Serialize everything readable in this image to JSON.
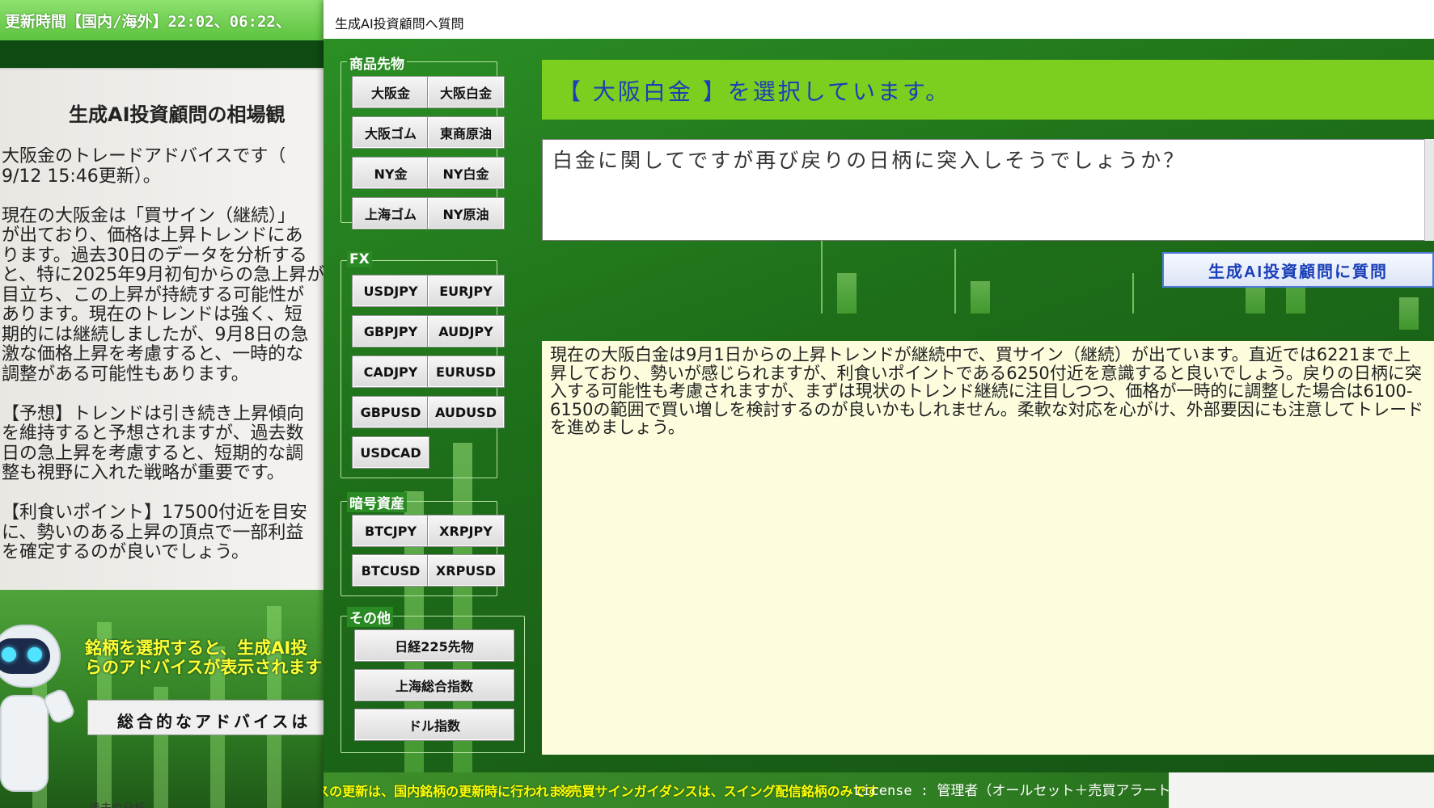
{
  "background_window": {
    "header_text": "更新時間【国内/海外】22:02、06:22、",
    "title": "生成AI投資顧問の相場観",
    "advice_text": "大阪金のトレードアドバイスです（\n9/12 15:46更新）。\n\n現在の大阪金は「買サイン（継続）」\nが出ており、価格は上昇トレンドにあ\nります。過去30日のデータを分析する\nと、特に2025年9月初旬からの急上昇が\n目立ち、この上昇が持続する可能性が\nあります。現在のトレンドは強く、短\n期的には継続しましたが、9月8日の急\n激な価格上昇を考慮すると、一時的な\n調整がある可能性もあります。\n\n【予想】トレンドは引き続き上昇傾向\nを維持すると予想されますが、過去数\n日の急上昇を考慮すると、短期的な調\n整も視野に入れた戦略が重要です。\n\n【利食いポイント】17500付近を目安\nに、勢いのある上昇の頂点で一部利益\nを確定するのが良いでしょう。",
    "yellow_note": "銘柄を選択すると、生成AI投\nらのアドバイスが表示されます",
    "overall_button": "総合的なアドバイスは",
    "bottom_text": "過去の分析"
  },
  "dialog": {
    "title": "生成AI投資顧問へ質問",
    "groups": {
      "commodities": {
        "label": "商品先物",
        "buttons": [
          "大阪金",
          "大阪白金",
          "大阪ゴム",
          "東商原油",
          "NY金",
          "NY白金",
          "上海ゴム",
          "NY原油"
        ]
      },
      "fx": {
        "label": "FX",
        "buttons": [
          "USDJPY",
          "EURJPY",
          "GBPJPY",
          "AUDJPY",
          "CADJPY",
          "EURUSD",
          "GBPUSD",
          "AUDUSD",
          "USDCAD"
        ]
      },
      "crypto": {
        "label": "暗号資産",
        "buttons": [
          "BTCJPY",
          "XRPJPY",
          "BTCUSD",
          "XRPUSD"
        ]
      },
      "other": {
        "label": "その他",
        "buttons": [
          "日経225先物",
          "上海総合指数",
          "ドル指数"
        ]
      }
    },
    "selected_banner": "【 大阪白金 】を選択しています。",
    "question_text": "白金に関してですが再び戻りの日柄に突入しそうでしょうか？",
    "ask_button": "生成AI投資顧問に質問",
    "answer_text": "現在の大阪白金は9月1日からの上昇トレンドが継続中で、買サイン（継続）が出ています。直近では6221まで上昇しており、勢いが感じられますが、利食いポイントである6250付近を意識すると良いでしょう。戻りの日柄に突入する可能性も考慮されますが、まずは現状のトレンド継続に注目しつつ、価格が一時的に調整した場合は6100-6150の範囲で買い増しを検討するのが良いかもしれません。柔軟な対応を心がけ、外部要因にも注意してトレードを進めましょう。",
    "notice_update": "※アドバイスの更新は、国内銘柄の更新時に行われます",
    "notice_signal": "※売買サインガイダンスは、スイング配信銘柄のみです",
    "license": "License : 管理者（オールセット＋売買アラート）"
  },
  "colors": {
    "green_dark": "#145214",
    "green_accent": "#7ccf1e",
    "banner_text": "#1a3fb8",
    "answer_bg": "#fdfdde",
    "notice_yellow": "#ffff00"
  }
}
